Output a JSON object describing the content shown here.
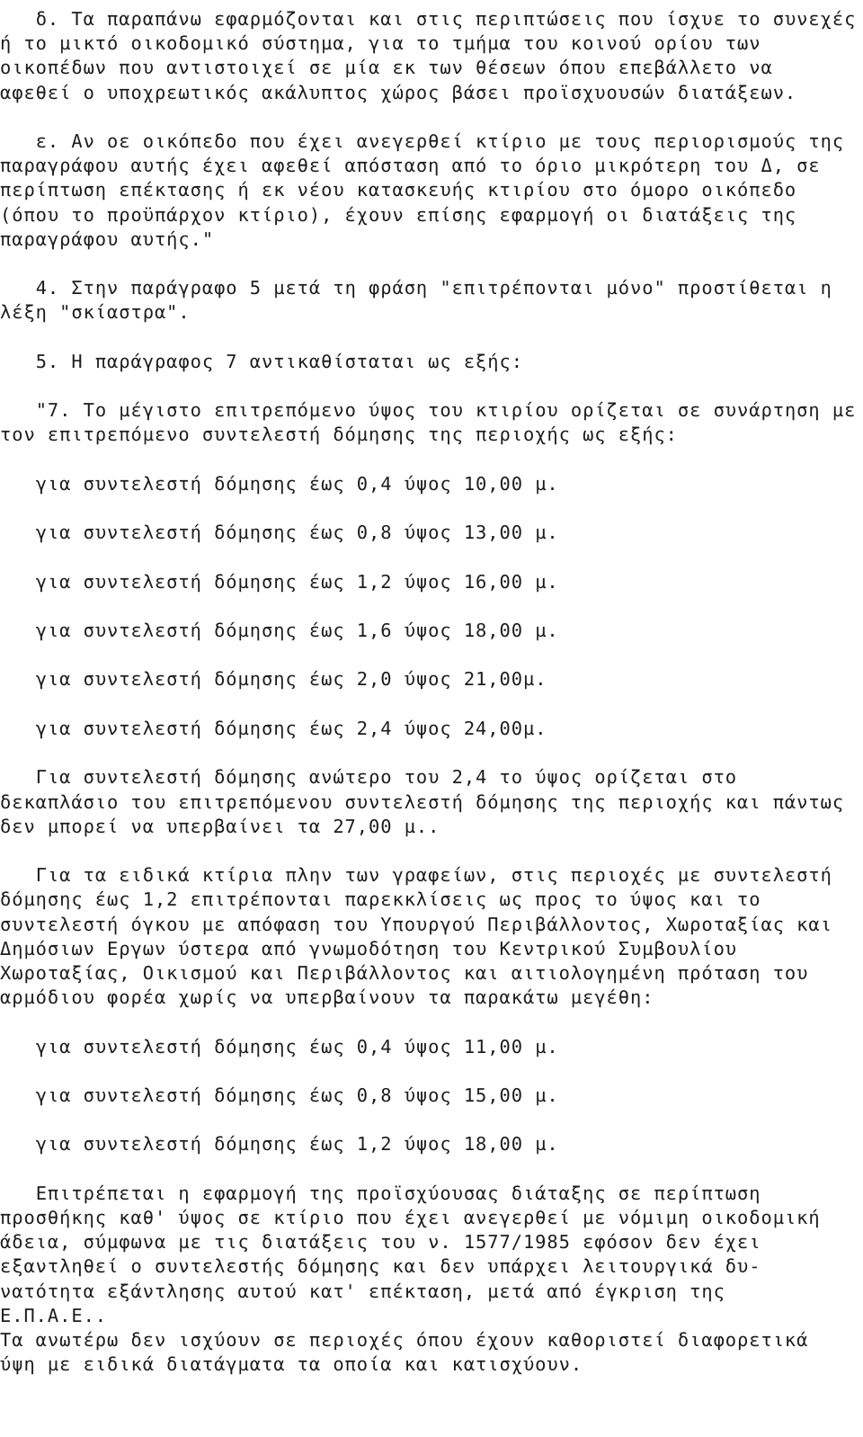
{
  "document": {
    "language": "Greek",
    "kind": "legal-regulation-text",
    "background_color": "#ffffff",
    "text_color": "#1c1c1c",
    "body_text": "   δ. Τα παραπάνω εφαρμόζονται και στις περιπτώσεις που ίσχυε το συνεχές\nή το μικτό οικοδομικό σύστημα, για το τμήμα του κοινού ορίου των\nοικοπέδων που αντιστοιχεί σε μία εκ των θέσεων όπου επεβάλλετο να\nαφεθεί ο υποχρεωτικός ακάλυπτος χώρος βάσει προϊσχυουσών διατάξεων.\n\n   ε. Αν οε οικόπεδο που έχει ανεγερθεί κτίριο με τους περιορισμούς της\nπαραγράφου αυτής έχει αφεθεί απόσταση από το όριο μικρότερη του Δ, σε\nπερίπτωση επέκτασης ή εκ νέου κατασκευής κτιρίου στο όμορο οικόπεδο\n(όπου το προϋπάρχον κτίριο), έχουν επίσης εφαρμογή οι διατάξεις της\nπαραγράφου αυτής.\"\n\n   4. Στην παράγραφο 5 μετά τη φράση \"επιτρέπονται μόνο\" προστίθεται η\nλέξη \"σκίαστρα\".\n\n   5. Η παράγραφος 7 αντικαθίσταται ως εξής:\n\n   \"7. Το μέγιστο επιτρεπόμενο ύψος του κτιρίου ορίζεται σε συνάρτηση με\nτον επιτρεπόμενο συντελεστή δόμησης της περιοχής ως εξής:\n\n   για συντελεστή δόμησης έως 0,4 ύψος 10,00 μ.\n\n   για συντελεστή δόμησης έως 0,8 ύψος 13,00 μ.\n\n   για συντελεστή δόμησης έως 1,2 ύψος 16,00 μ.\n\n   για συντελεστή δόμησης έως 1,6 ύψος 18,00 μ.\n\n   για συντελεστή δόμησης έως 2,0 ύψος 21,00μ.\n\n   για συντελεστή δόμησης έως 2,4 ύψος 24,00μ.\n\n   Για συντελεστή δόμησης ανώτερο του 2,4 το ύψος ορίζεται στο\nδεκαπλάσιο του επιτρεπόμενου συντελεστή δόμησης της περιοχής και πάντως\nδεν μπορεί να υπερβαίνει τα 27,00 μ..\n\n   Για τα ειδικά κτίρια πλην των γραφείων, στις περιοχές με συντελεστή\nδόμησης έως 1,2 επιτρέπονται παρεκκλίσεις ως προς το ύψος και το\nσυντελεστή όγκου με απόφαση του Υπουργού Περιβάλλοντος, Χωροταξίας και\nΔημόσιων Εργων ύστερα από γνωμοδότηση του Κεντρικού Συμβουλίου\nΧωροταξίας, Οικισμού και Περιβάλλοντος και αιτιολογημένη πρόταση του\nαρμόδιου φορέα χωρίς να υπερβαίνουν τα παρακάτω μεγέθη:\n\n   για συντελεστή δόμησης έως 0,4 ύψος 11,00 μ.\n\n   για συντελεστή δόμησης έως 0,8 ύψος 15,00 μ.\n\n   για συντελεστή δόμησης έως 1,2 ύψος 18,00 μ.\n\n   Επιτρέπεται η εφαρμογή της προϊσχύουσας διάταξης σε περίπτωση\nπροσθήκης καθ' ύψος σε κτίριο που έχει ανεγερθεί με νόμιμη οικοδομική\nάδεια, σύμφωνα με τις διατάξεις του ν. 1577/1985 εφόσον δεν έχει\nεξαντληθεί ο συντελεστής δόμησης και δεν υπάρχει λειτουργικά δυ-\nνατότητα εξάντλησης αυτού κατ' επέκταση, μετά από έγκριση της\nΕ.Π.Α.Ε..\nΤα ανωτέρω δεν ισχύουν σε περιοχές όπου έχουν καθοριστεί διαφορετικά\nύψη με ειδικά διατάγματα τα οποία και κατισχύουν."
  }
}
